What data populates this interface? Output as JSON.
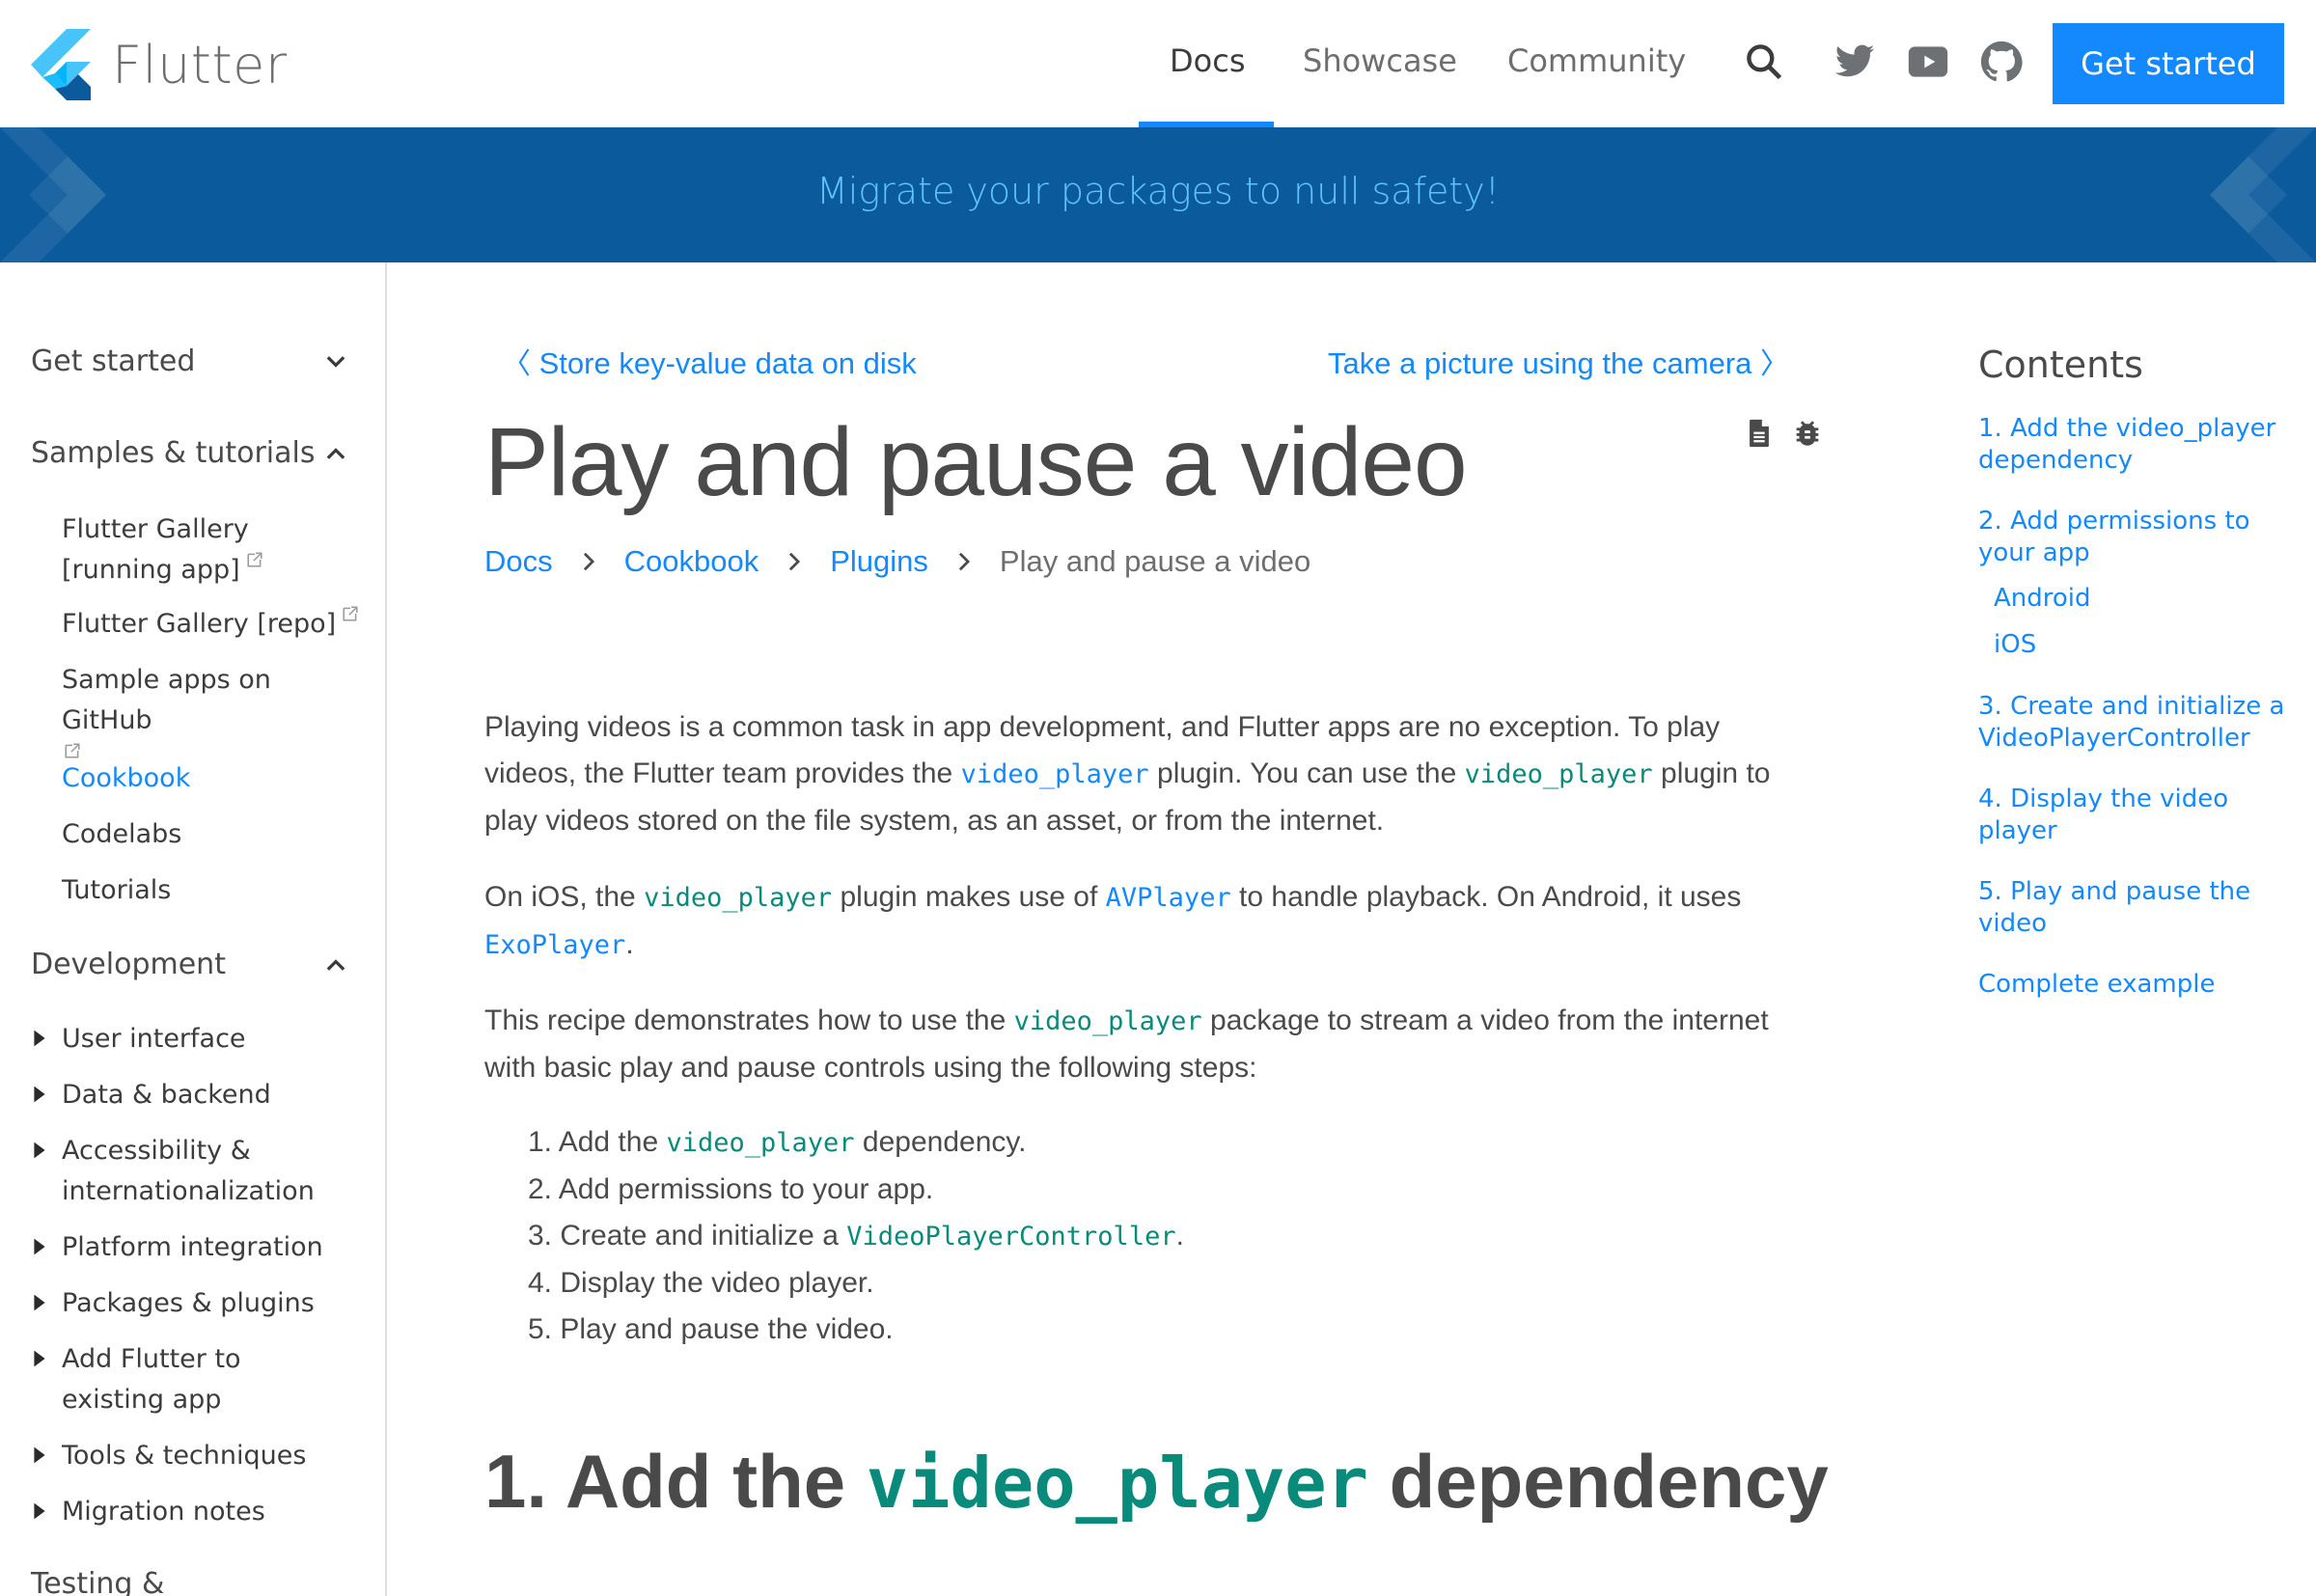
{
  "header": {
    "brand": "Flutter",
    "nav": [
      {
        "label": "Docs",
        "active": true
      },
      {
        "label": "Showcase",
        "active": false
      },
      {
        "label": "Community",
        "active": false
      }
    ],
    "icons": [
      "search-icon",
      "twitter-icon",
      "youtube-icon",
      "github-icon"
    ],
    "cta_label": "Get started"
  },
  "banner": {
    "text": "Migrate your packages to null safety!"
  },
  "sidebar": {
    "sections": [
      {
        "label": "Get started",
        "expanded": false
      },
      {
        "label": "Samples & tutorials",
        "expanded": true
      },
      {
        "label": "Development",
        "expanded": true
      },
      {
        "label": "Testing &",
        "expanded": false
      }
    ],
    "samples_items": [
      {
        "label": "Flutter Gallery [running app]",
        "external": true
      },
      {
        "label": "Flutter Gallery [repo]",
        "external": true
      },
      {
        "label": "Sample apps on GitHub",
        "external": true
      },
      {
        "label": "Cookbook",
        "active": true
      },
      {
        "label": "Codelabs"
      },
      {
        "label": "Tutorials"
      }
    ],
    "development_items": [
      {
        "label": "User interface"
      },
      {
        "label": "Data & backend"
      },
      {
        "label": "Accessibility & internationalization"
      },
      {
        "label": "Platform integration"
      },
      {
        "label": "Packages & plugins"
      },
      {
        "label": "Add Flutter to existing app"
      },
      {
        "label": "Tools & techniques"
      },
      {
        "label": "Migration notes"
      }
    ]
  },
  "main": {
    "prev_link": "Store key-value data on disk",
    "next_link": "Take a picture using the camera",
    "title": "Play and pause a video",
    "title_icons": [
      "document-icon",
      "bug-icon"
    ],
    "breadcrumb": [
      {
        "label": "Docs",
        "link": true
      },
      {
        "label": "Cookbook",
        "link": true
      },
      {
        "label": "Plugins",
        "link": true
      },
      {
        "label": "Play and pause a video",
        "link": false
      }
    ],
    "para1": {
      "t1": "Playing videos is a common task in app development, and Flutter apps are no exception. To play videos, the Flutter team provides the ",
      "link1": "video_player",
      "t2": " plugin. You can use the ",
      "code1": "video_player",
      "t3": " plugin to play videos stored on the file system, as an asset, or from the internet."
    },
    "para2": {
      "t1": "On iOS, the ",
      "code1": "video_player",
      "t2": " plugin makes use of ",
      "link1": "AVPlayer",
      "t3": " to handle playback. On Android, it uses ",
      "link2": "ExoPlayer",
      "t4": "."
    },
    "para3": {
      "t1": "This recipe demonstrates how to use the ",
      "code1": "video_player",
      "t2": " package to stream a video from the internet with basic play and pause controls using the following steps:"
    },
    "steps": [
      {
        "num": "1.",
        "pre": "Add the ",
        "code": "video_player",
        "post": " dependency."
      },
      {
        "num": "2.",
        "pre": "Add permissions to your app.",
        "code": "",
        "post": ""
      },
      {
        "num": "3.",
        "pre": "Create and initialize a ",
        "code": "VideoPlayerController",
        "post": "."
      },
      {
        "num": "4.",
        "pre": "Display the video player.",
        "code": "",
        "post": ""
      },
      {
        "num": "5.",
        "pre": "Play and pause the video.",
        "code": "",
        "post": ""
      }
    ],
    "heading1": {
      "pre": "1. Add the ",
      "code": "video_player",
      "post": " dependency"
    }
  },
  "toc": {
    "title": "Contents",
    "items": [
      {
        "label": "1. Add the video_player dependency",
        "sub": false
      },
      {
        "label": "2. Add permissions to your app",
        "sub": false
      },
      {
        "label": "Android",
        "sub": true
      },
      {
        "label": "iOS",
        "sub": true
      },
      {
        "label": "3. Create and initialize a VideoPlayerController",
        "sub": false
      },
      {
        "label": "4. Display the video player",
        "sub": false
      },
      {
        "label": "5. Play and pause the video",
        "sub": false
      },
      {
        "label": "Complete example",
        "sub": false
      }
    ]
  },
  "colors": {
    "accent": "#1389fd",
    "banner_bg": "#0a5a9c",
    "banner_text": "#5fc4f8",
    "code": "#0a8a7a",
    "text": "#4a4a4a"
  }
}
